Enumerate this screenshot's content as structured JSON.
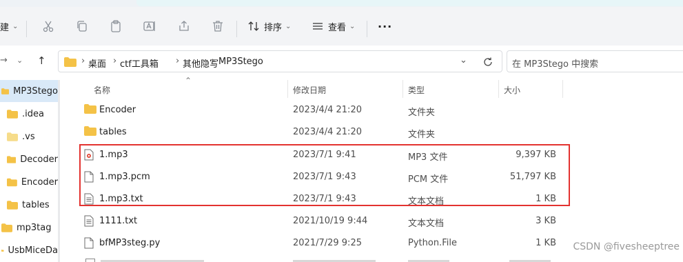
{
  "toolbar": {
    "new_label": "建",
    "sort_label": "排序",
    "view_label": "查看",
    "more_label": "···"
  },
  "address": {
    "crumbs": [
      "桌面",
      "ctf工具箱",
      "其他隐写",
      "MP3Stego"
    ]
  },
  "search": {
    "placeholder": "在 MP3Stego 中搜索"
  },
  "nav": {
    "items": [
      {
        "label": "MP3Stego",
        "selected": true
      },
      {
        "label": ".idea"
      },
      {
        "label": ".vs"
      },
      {
        "label": "Decoder"
      },
      {
        "label": "Encoder"
      },
      {
        "label": "tables"
      },
      {
        "label": "mp3tag"
      },
      {
        "label": "UsbMiceDa"
      }
    ]
  },
  "columns": {
    "name": "名称",
    "date": "修改日期",
    "type": "类型",
    "size": "大小"
  },
  "files": [
    {
      "name": "Encoder",
      "date": "2023/4/4 21:20",
      "type": "文件夹",
      "size": "",
      "icon": "folder-icon"
    },
    {
      "name": "tables",
      "date": "2023/4/4 21:20",
      "type": "文件夹",
      "size": "",
      "icon": "folder-icon"
    },
    {
      "name": "1.mp3",
      "date": "2023/7/1 9:41",
      "type": "MP3 文件",
      "size": "9,397 KB",
      "icon": "audio-file-icon"
    },
    {
      "name": "1.mp3.pcm",
      "date": "2023/7/1 9:43",
      "type": "PCM 文件",
      "size": "51,797 KB",
      "icon": "file-icon"
    },
    {
      "name": "1.mp3.txt",
      "date": "2023/7/1 9:43",
      "type": "文本文档",
      "size": "1 KB",
      "icon": "text-file-icon"
    },
    {
      "name": "1111.txt",
      "date": "2021/10/19 9:44",
      "type": "文本文档",
      "size": "3 KB",
      "icon": "text-file-icon"
    },
    {
      "name": "bfMP3steg.py",
      "date": "2021/7/29 9:25",
      "type": "Python.File",
      "size": "1 KB",
      "icon": "file-icon"
    }
  ],
  "watermark": "CSDN @fivesheeptree",
  "colors": {
    "highlight": "#e3322f",
    "folder": "#f4c247",
    "selection": "#d9e9f8"
  }
}
